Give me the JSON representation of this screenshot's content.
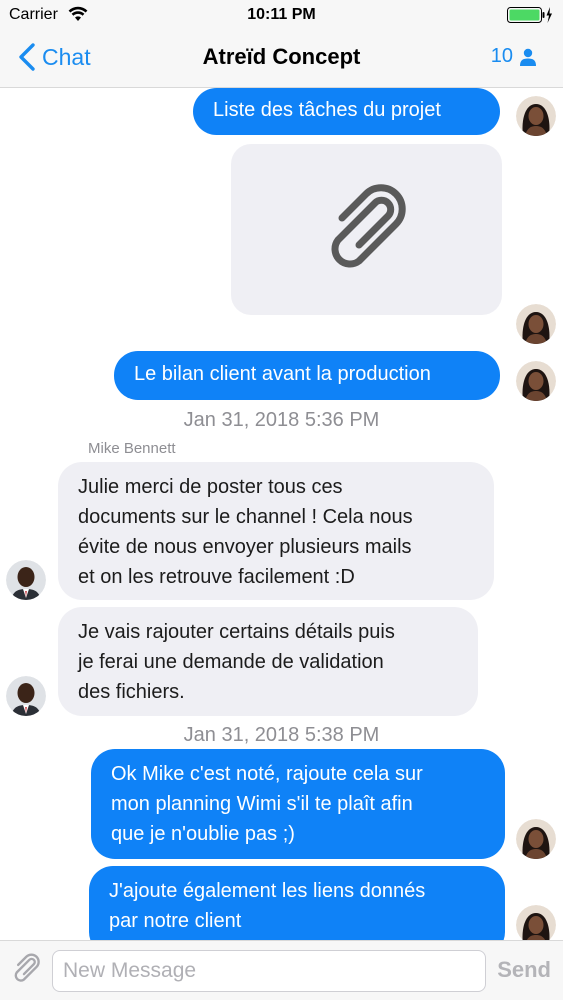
{
  "status_bar": {
    "carrier": "Carrier",
    "time": "10:11 PM",
    "wifi_icon": "wifi-icon",
    "battery_icon": "battery-charging-icon"
  },
  "nav": {
    "back_label": "Chat",
    "title": "Atreïd Concept",
    "member_count": "10",
    "accent_color": "#1a8cf0"
  },
  "messages": [
    {
      "kind": "outgoing",
      "text": "Liste des tâches du projet"
    },
    {
      "kind": "outgoing-attachment",
      "icon": "paperclip-icon"
    },
    {
      "kind": "outgoing",
      "text": "Le bilan client avant la production"
    },
    {
      "kind": "timestamp",
      "text": "Jan 31, 2018 5:36 PM"
    },
    {
      "kind": "sender",
      "text": "Mike Bennett"
    },
    {
      "kind": "incoming",
      "text": "Julie merci de poster tous ces\ndocuments sur le channel ! Cela nous\névite de nous envoyer plusieurs mails\net on les retrouve facilement :D"
    },
    {
      "kind": "incoming",
      "text": "Je vais rajouter certains détails puis\nje ferai une demande de validation\ndes fichiers."
    },
    {
      "kind": "timestamp",
      "text": "Jan 31, 2018 5:38 PM"
    },
    {
      "kind": "outgoing",
      "text": "Ok Mike c'est noté, rajoute cela sur\nmon planning Wimi s'il te plaît afin\nque je n'oublie pas ;)"
    },
    {
      "kind": "outgoing",
      "text": "J'ajoute également les liens donnés\npar notre client"
    }
  ],
  "colors": {
    "outgoing_bubble": "#0f82f7",
    "incoming_bubble": "#efeff4",
    "timestamp_text": "#8e8e93"
  },
  "composer": {
    "placeholder": "New Message",
    "send_label": "Send",
    "attach_icon": "paperclip-icon"
  }
}
